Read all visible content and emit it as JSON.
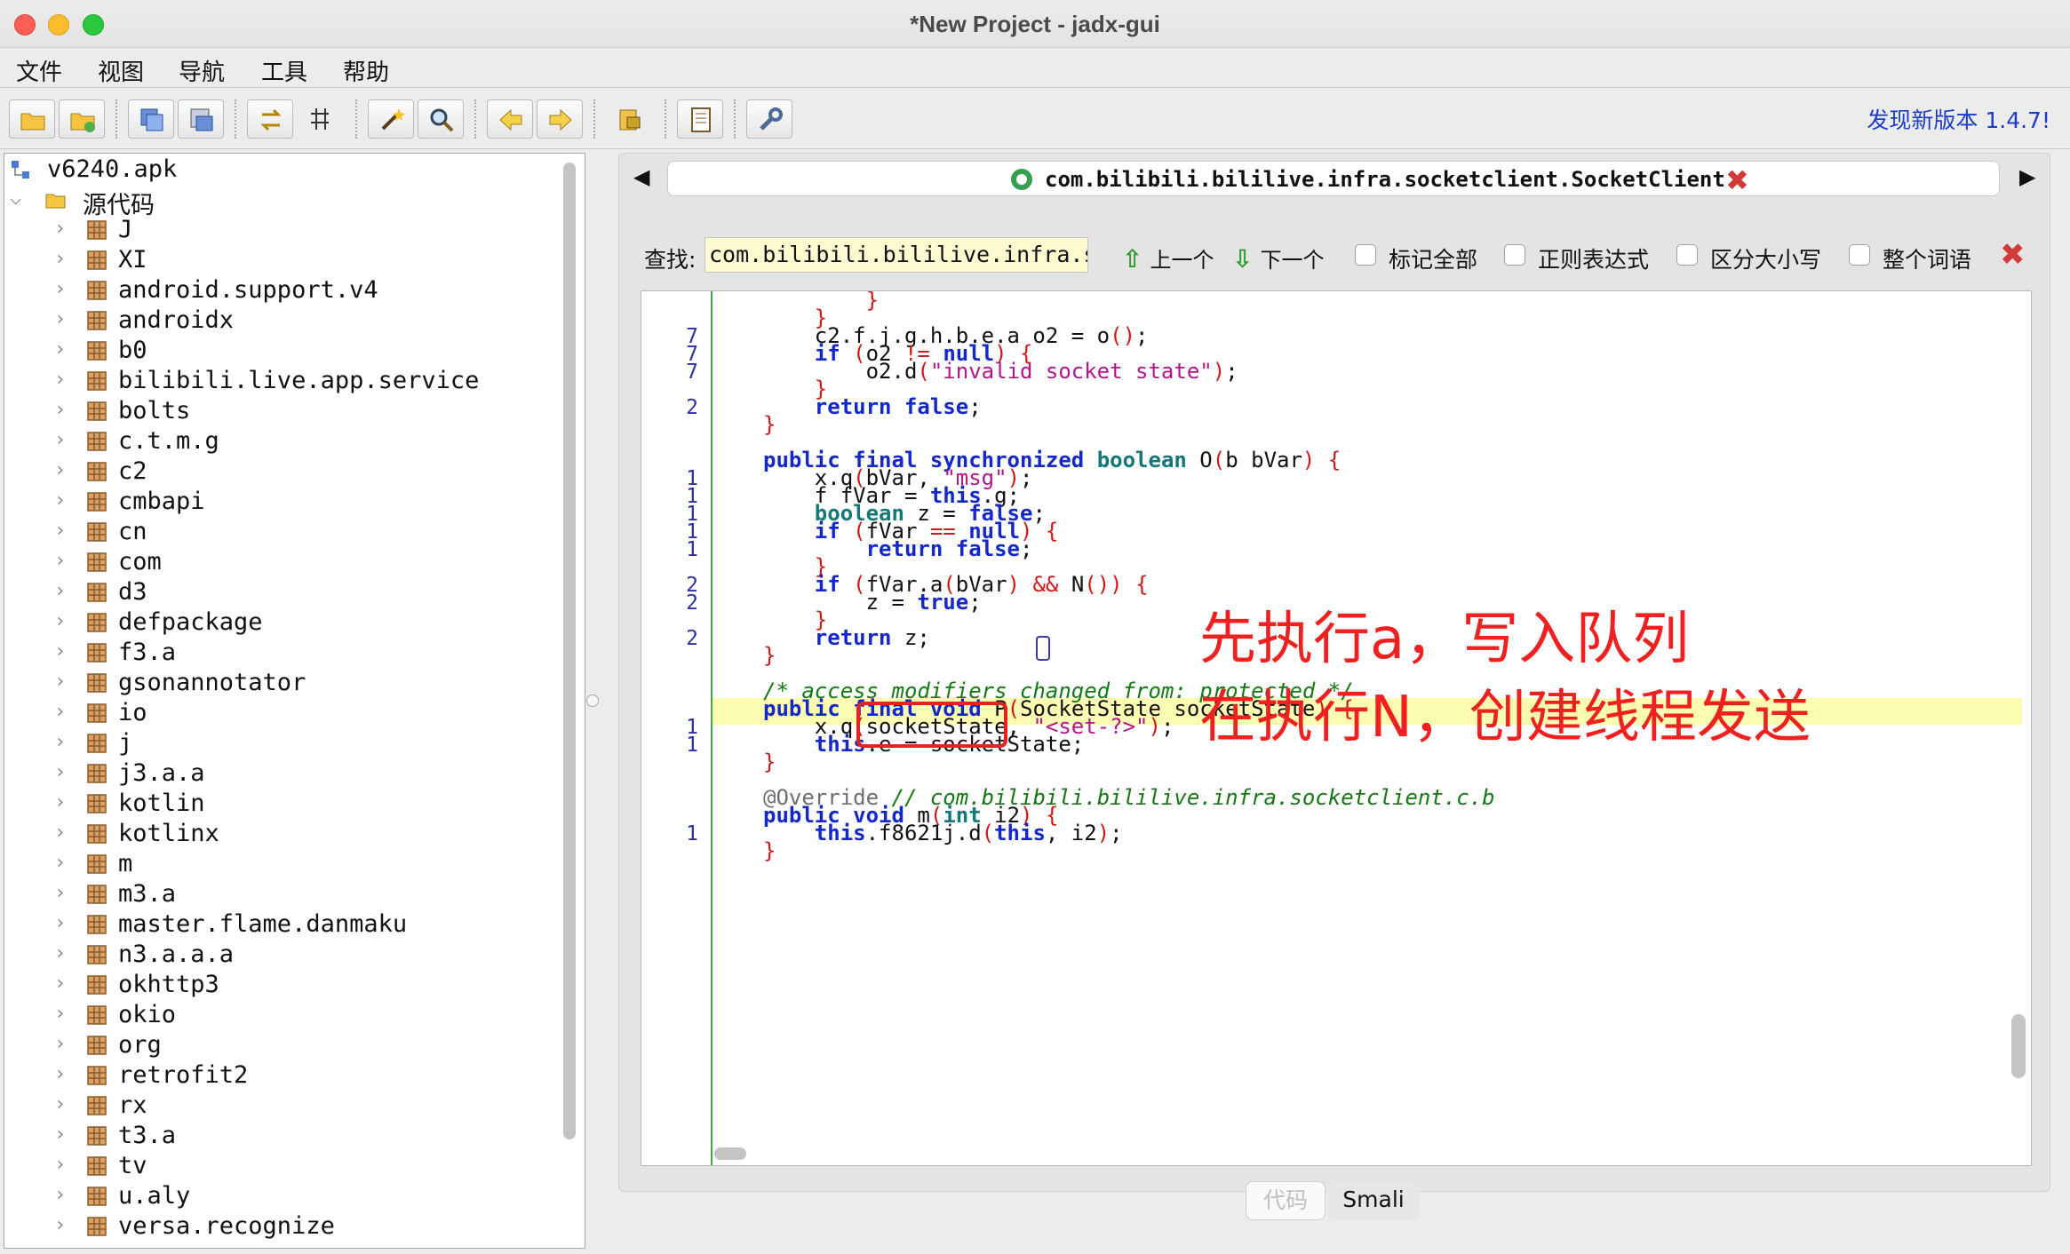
{
  "window": {
    "title": "*New Project - jadx-gui"
  },
  "menu": [
    "文件",
    "视图",
    "导航",
    "工具",
    "帮助"
  ],
  "toolbar": {
    "update_text": "发现新版本 1.4.7!"
  },
  "tree": {
    "root": "v6240.apk",
    "source_folder": "源代码",
    "packages": [
      "J",
      "XI",
      "android.support.v4",
      "androidx",
      "b0",
      "bilibili.live.app.service",
      "bolts",
      "c.t.m.g",
      "c2",
      "cmbapi",
      "cn",
      "com",
      "d3",
      "defpackage",
      "f3.a",
      "gsonannotator",
      "io",
      "j",
      "j3.a.a",
      "kotlin",
      "kotlinx",
      "m",
      "m3.a",
      "master.flame.danmaku",
      "n3.a.a.a",
      "okhttp3",
      "okio",
      "org",
      "retrofit2",
      "rx",
      "t3.a",
      "tv",
      "u.aly",
      "versa.recognize"
    ]
  },
  "editor": {
    "tab_title": "com.bilibili.bililive.infra.socketclient.SocketClient",
    "search": {
      "label": "查找:",
      "value": "com.bilibili.bililive.infra.socketclie",
      "prev": "上一个",
      "next": "下一个",
      "options": [
        "标记全部",
        "正则表达式",
        "区分大小写",
        "整个词语"
      ]
    },
    "line_numbers": [
      "",
      "",
      "7",
      "7",
      "7",
      "",
      "2",
      "",
      "",
      "",
      "1",
      "1",
      "1",
      "1",
      "1",
      "",
      "2",
      "2",
      "",
      "2",
      "",
      "",
      "",
      "",
      "1",
      "1",
      "",
      "",
      "",
      "",
      "1",
      ""
    ],
    "bottom_tabs": [
      "代码",
      "Smali"
    ]
  },
  "annotation": {
    "line1": "先执行a，写入队列",
    "line2": "在执行N，创建线程发送"
  }
}
